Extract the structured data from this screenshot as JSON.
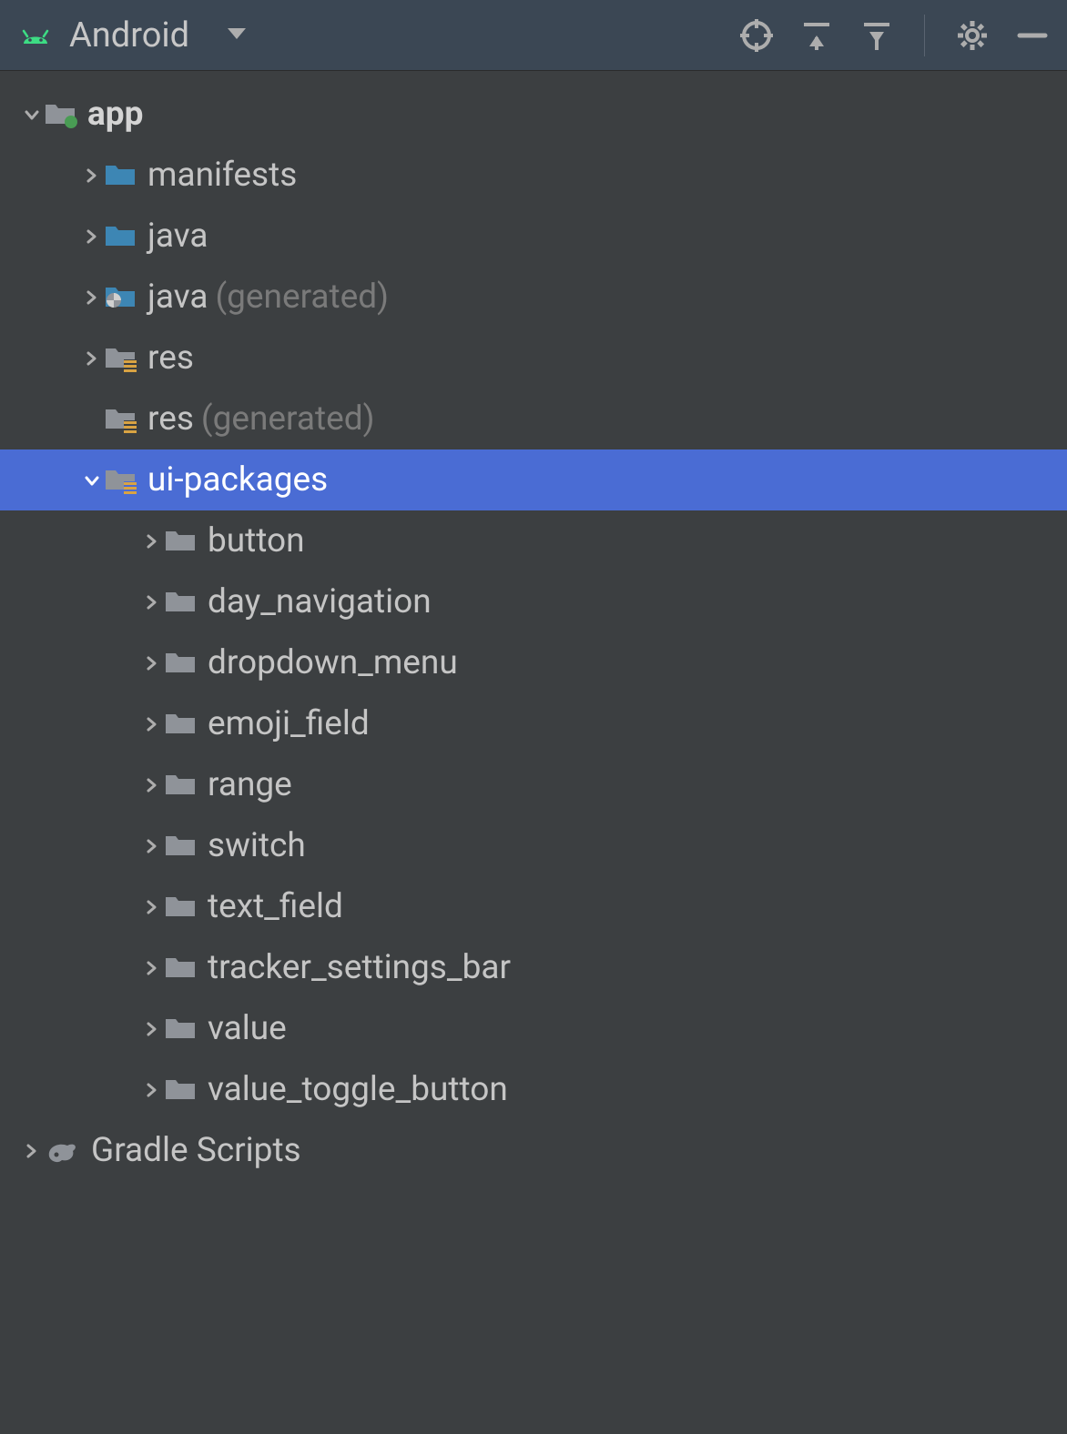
{
  "toolbar": {
    "title": "Android"
  },
  "tree": {
    "root": {
      "label": "app"
    },
    "items": [
      {
        "label": "manifests",
        "suffix": ""
      },
      {
        "label": "java",
        "suffix": ""
      },
      {
        "label": "java",
        "suffix": "(generated)"
      },
      {
        "label": "res",
        "suffix": ""
      },
      {
        "label": "res",
        "suffix": "(generated)"
      },
      {
        "label": "ui-packages",
        "suffix": ""
      }
    ],
    "uiPackages": [
      {
        "label": "button"
      },
      {
        "label": "day_navigation"
      },
      {
        "label": "dropdown_menu"
      },
      {
        "label": "emoji_field"
      },
      {
        "label": "range"
      },
      {
        "label": "switch"
      },
      {
        "label": "text_field"
      },
      {
        "label": "tracker_settings_bar"
      },
      {
        "label": "value"
      },
      {
        "label": "value_toggle_button"
      }
    ],
    "gradle": {
      "label": "Gradle Scripts"
    }
  }
}
